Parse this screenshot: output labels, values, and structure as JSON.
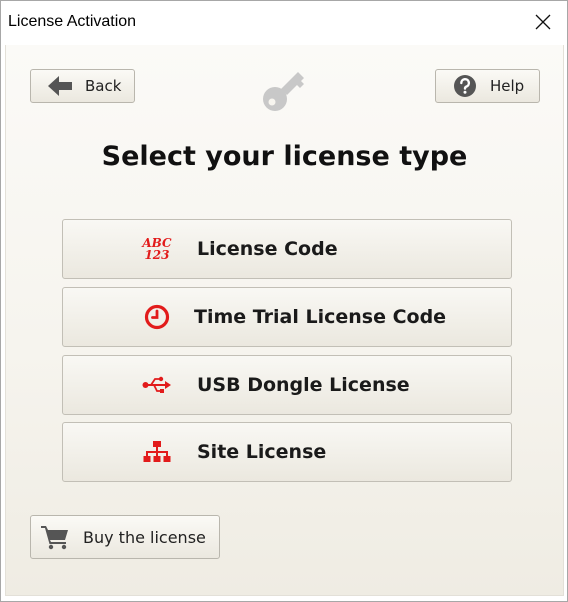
{
  "window": {
    "title": "License Activation"
  },
  "toolbar": {
    "back_label": "Back",
    "help_label": "Help"
  },
  "heading": "Select your license type",
  "options": [
    {
      "label": "License Code",
      "icon": "abc-123-icon",
      "icon_text_top": "ABC",
      "icon_text_bottom": "123"
    },
    {
      "label": "Time Trial License Code",
      "icon": "clock-icon"
    },
    {
      "label": "USB Dongle License",
      "icon": "usb-icon"
    },
    {
      "label": "Site License",
      "icon": "network-tree-icon"
    }
  ],
  "footer": {
    "buy_label": "Buy the license"
  },
  "colors": {
    "accent_red": "#e21b1b",
    "icon_gray": "#555555",
    "key_gray": "#c8c8c8"
  }
}
